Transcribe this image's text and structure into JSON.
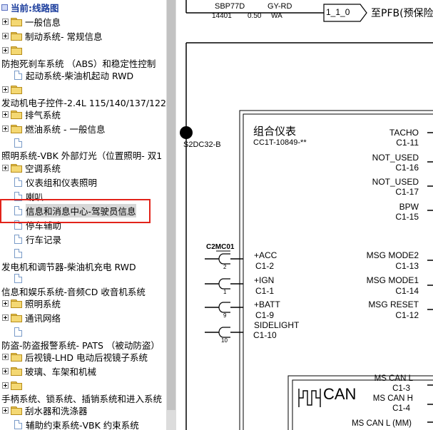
{
  "tree": {
    "title": "当前:线路图",
    "items": [
      "一般信息",
      "制动系统- 常规信息",
      "",
      "防抱死刹车系统 （ABS）和稳定性控制",
      "起动系统-柴油机起动 RWD",
      "",
      "发动机电子控件-2.4L 115/140/137/122",
      "排气系统",
      "燃油系统 - 一般信息",
      "",
      "照明系统-VBK 外部灯光（位置照明- 双1",
      "空调系统",
      "仪表组和仪表照明",
      "喇叭",
      "信息和消息中心-驾驶员信息",
      "停车辅助",
      "行车记录",
      "",
      "发电机和调节器-柴油机充电 RWD",
      "",
      "信息和娱乐系统-音频CD 收音机系统",
      "照明系统",
      "通讯网络",
      "",
      "防盗-防盗报警系统- PATS （被动防盗）",
      "后视镜-LHD 电动后视镜子系统",
      "玻璃、车架和机械",
      "",
      "手柄系统、锁系统、插销系统和进入系统",
      "刮水器和洗涤器",
      "辅助约束系统-VBK 约束系统"
    ]
  },
  "diagram": {
    "top_wire": "SBP77D",
    "top_color": "GY-RD",
    "top_num": "14401",
    "top_size": "0.50",
    "top_code": "WA",
    "top_ref": "1_1_0",
    "top_dest": "至PFB(预保险",
    "splice": "S2DC32-B",
    "module_name": "组合仪表",
    "module_part": "CC1T-10849-**",
    "connector": "C2MC01",
    "right_pins": [
      {
        "name": "TACHO",
        "pin": "C1-11"
      },
      {
        "name": "NOT_USED",
        "pin": "C1-16"
      },
      {
        "name": "NOT_USED",
        "pin": "C1-17"
      },
      {
        "name": "BPW",
        "pin": "C1-15"
      },
      {
        "name": "MSG MODE2",
        "pin": "C1-13"
      },
      {
        "name": "MSG MODE1",
        "pin": "C1-14"
      },
      {
        "name": "MSG RESET",
        "pin": "C1-12"
      }
    ],
    "left_pins": [
      {
        "name": "+ACC",
        "pin": "C1-2",
        "num": "2"
      },
      {
        "name": "+IGN",
        "pin": "C1-1",
        "num": "1"
      },
      {
        "name": "+BATT",
        "pin": "C1-9",
        "num": "9"
      },
      {
        "name": "SIDELIGHT",
        "pin": "C1-10",
        "num": "10"
      }
    ],
    "can_label": "CAN",
    "can_pins": [
      {
        "name": "MS CAN L",
        "pin": "C1-3"
      },
      {
        "name": "MS CAN H",
        "pin": "C1-4"
      },
      {
        "name": "MS CAN L (MM)",
        "pin": ""
      }
    ]
  }
}
